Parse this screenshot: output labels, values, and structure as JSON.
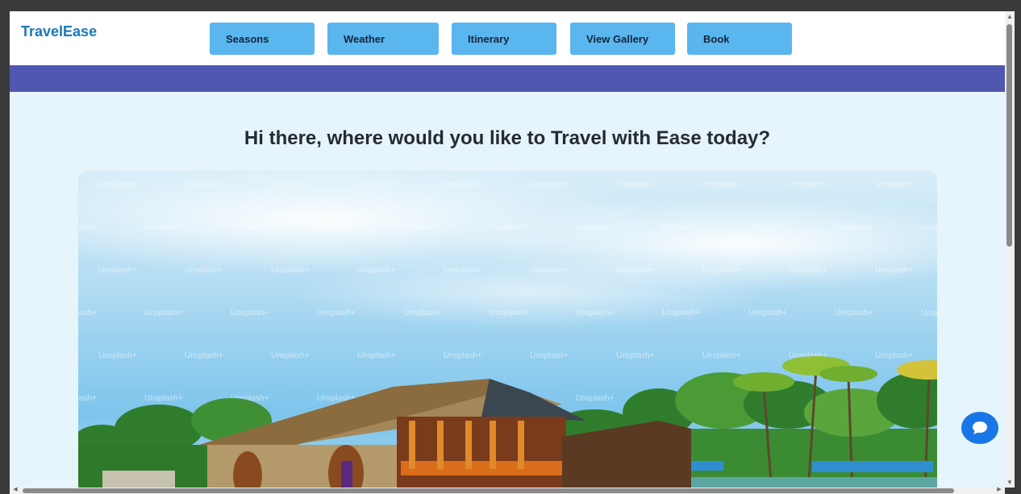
{
  "header": {
    "logo": "TravelEase",
    "nav": [
      {
        "label": "Seasons"
      },
      {
        "label": "Weather"
      },
      {
        "label": "Itinerary"
      },
      {
        "label": "View Gallery"
      },
      {
        "label": "Book"
      }
    ]
  },
  "main": {
    "heading": "Hi there, where would you like to Travel with Ease today?",
    "hero_watermark": "Unsplash+"
  },
  "chat": {
    "icon": "chat-bubble-icon"
  },
  "colors": {
    "logo": "#1b78b6",
    "nav_button": "#5ab6ef",
    "banner": "#4f57b0",
    "page_background": "#e6f4fc",
    "chat_button": "#1976e6"
  }
}
